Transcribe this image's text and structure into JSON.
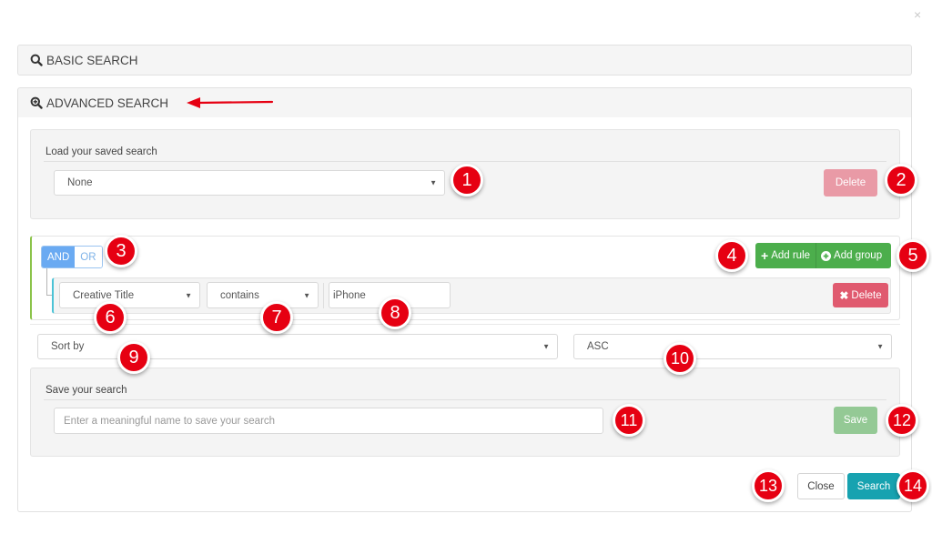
{
  "modal": {
    "close_glyph": "×"
  },
  "basic_search": {
    "label": "BASIC SEARCH",
    "icon": "search-icon"
  },
  "advanced_search": {
    "label": "ADVANCED SEARCH",
    "icon": "zoom-in-icon"
  },
  "saved_search": {
    "label": "Load your saved search",
    "selected": "None",
    "delete_label": "Delete",
    "delete_color": "#e99aa6"
  },
  "query_builder": {
    "conditions": [
      "AND",
      "OR"
    ],
    "active_condition": "AND",
    "add_rule_label": "Add rule",
    "add_group_label": "Add group",
    "add_color": "#4cae4c",
    "rule": {
      "field": "Creative Title",
      "operator": "contains",
      "value": "iPhone",
      "delete_label": "Delete",
      "delete_color": "#e05a6f"
    }
  },
  "sort": {
    "sort_by_selected": "Sort by",
    "order_selected": "ASC"
  },
  "save_search": {
    "label": "Save your search",
    "placeholder": "Enter a meaningful name to save your  search",
    "save_label": "Save",
    "save_color": "#94c995"
  },
  "footer": {
    "close_label": "Close",
    "search_label": "Search",
    "search_color": "#17a2b0"
  },
  "annotations": [
    "1",
    "2",
    "3",
    "4",
    "5",
    "6",
    "7",
    "8",
    "9",
    "10",
    "11",
    "12",
    "13",
    "14"
  ],
  "annotation_color": "#e60012"
}
